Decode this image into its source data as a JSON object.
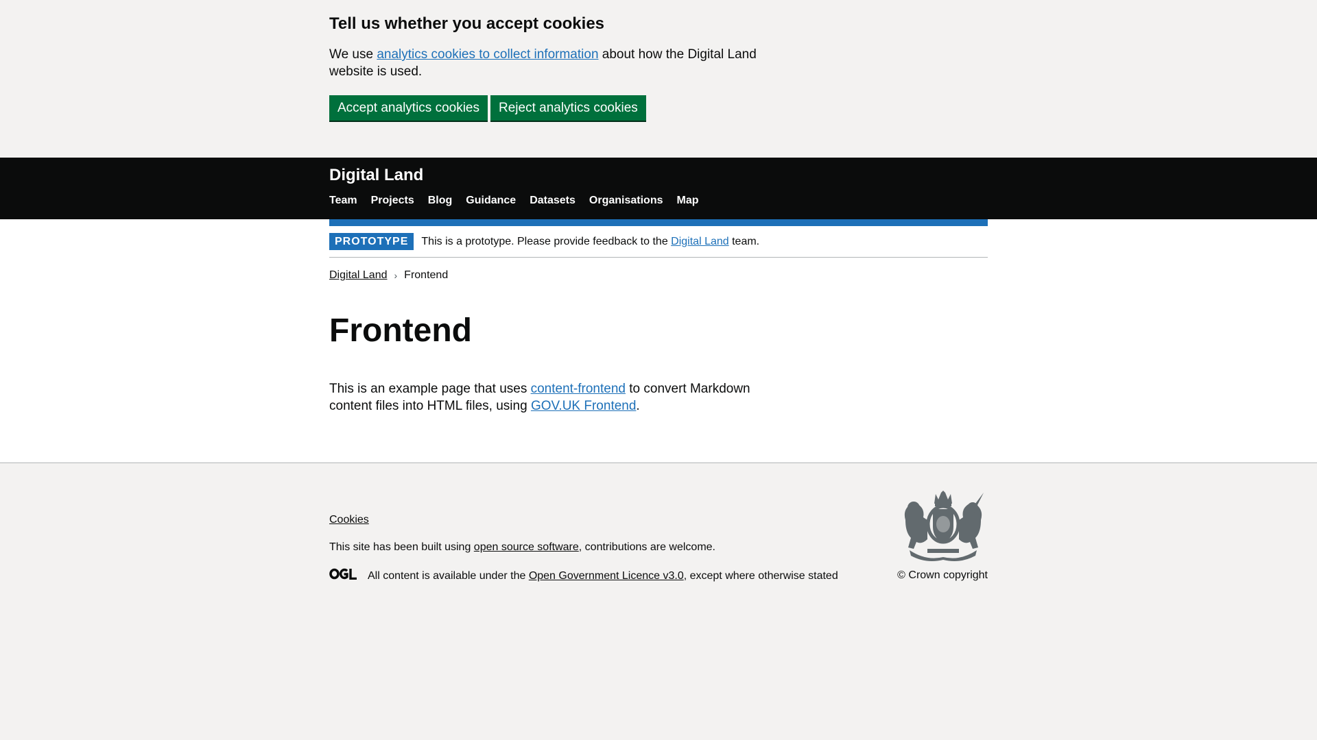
{
  "cookie_banner": {
    "heading": "Tell us whether you accept cookies",
    "text_before": "We use ",
    "link": "analytics cookies to collect information",
    "text_after": " about how the Digital Land website is used.",
    "accept_button": "Accept analytics cookies",
    "reject_button": "Reject analytics cookies"
  },
  "header": {
    "service_name": "Digital Land",
    "nav": [
      "Team",
      "Projects",
      "Blog",
      "Guidance",
      "Datasets",
      "Organisations",
      "Map"
    ]
  },
  "phase_banner": {
    "tag": "PROTOTYPE",
    "text_before": "This is a prototype. Please provide feedback to the ",
    "link": "Digital Land",
    "text_after": " team."
  },
  "breadcrumbs": {
    "home": "Digital Land",
    "sep": "›",
    "current": "Frontend"
  },
  "main": {
    "title": "Frontend",
    "text_1": "This is an example page that uses ",
    "link_1": "content-frontend",
    "text_2": " to convert Markdown content files into HTML files, using ",
    "link_2": "GOV.UK Frontend",
    "text_3": "."
  },
  "footer": {
    "cookies_link": "Cookies",
    "built_before": "This site has been built using ",
    "built_link": "open source software",
    "built_after": ", contributions are welcome.",
    "ogl_logo_text": "OGL",
    "licence_before": "All content is available under the ",
    "licence_link": "Open Government Licence v3.0",
    "licence_after": ", except where otherwise stated",
    "crest_icon": "royal-coat-of-arms-icon",
    "copyright": "© Crown copyright"
  },
  "colors": {
    "primary_button": "#00703c",
    "header_bg": "#0b0c0c",
    "link": "#1d70b8",
    "phase_tag": "#1d70b8",
    "page_bg": "#f3f2f1"
  }
}
